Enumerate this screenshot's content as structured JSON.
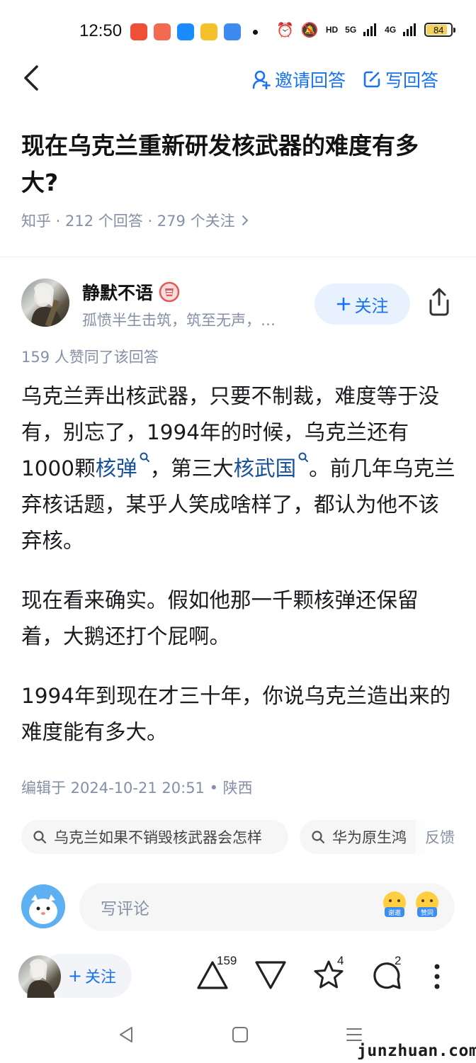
{
  "status_bar": {
    "time": "12:50",
    "app_icons": [
      "video-app-icon",
      "weibo-app-icon",
      "bilibili-app-icon",
      "shield-app-icon",
      "blue-app-icon"
    ],
    "app_colors": [
      "#f04e37",
      "#f26a4f",
      "#1a8cff",
      "#f5c12a",
      "#3d8bf0"
    ],
    "network_labels": [
      "HD",
      "5G",
      "4G"
    ],
    "battery": "84"
  },
  "topnav": {
    "invite_label": "邀请回答",
    "write_label": "写回答"
  },
  "question": {
    "title": "现在乌克兰重新研发核武器的难度有多大?",
    "meta": "知乎 · 212 个回答 · 279 个关注"
  },
  "author": {
    "name": "静默不语",
    "bio": "孤愤半生击筑，筑至无声，…",
    "follow_label": "关注",
    "likes_line": "159 人赞同了该回答"
  },
  "answer": {
    "p1_a": "乌克兰弄出核武器，只要不制裁，难度等于没有，别忘了，1994年的时候，乌克兰还有1000颗",
    "p1_kw1": "核弹",
    "p1_b": "，第三大",
    "p1_kw2": "核武国",
    "p1_c": "。前几年乌克兰弃核话题，某乎人笑成啥样了，都认为他不该弃核。",
    "p2": "现在看来确实。假如他那一千颗核弹还保留着，大鹅还打个屁啊。",
    "p3": "1994年到现在才三十年，你说乌克兰造出来的难度能有多大。",
    "edited": "编辑于 2024-10-21 20:51 • 陕西"
  },
  "related": {
    "items": [
      "乌克兰如果不销毁核武器会怎样",
      "华为原生鸿"
    ],
    "feedback": "反馈"
  },
  "comment": {
    "placeholder": "写评论",
    "emoji_1": "谢邀",
    "emoji_2": "赞同"
  },
  "bottom_bar": {
    "follow_label": "关注",
    "upvote_count": "159",
    "favorite_count": "4",
    "comment_count": "2"
  },
  "colors": {
    "accent": "#1772f6",
    "keyword": "#175199",
    "meta_gray": "#8590a6"
  },
  "watermark": "junzhuan.com"
}
